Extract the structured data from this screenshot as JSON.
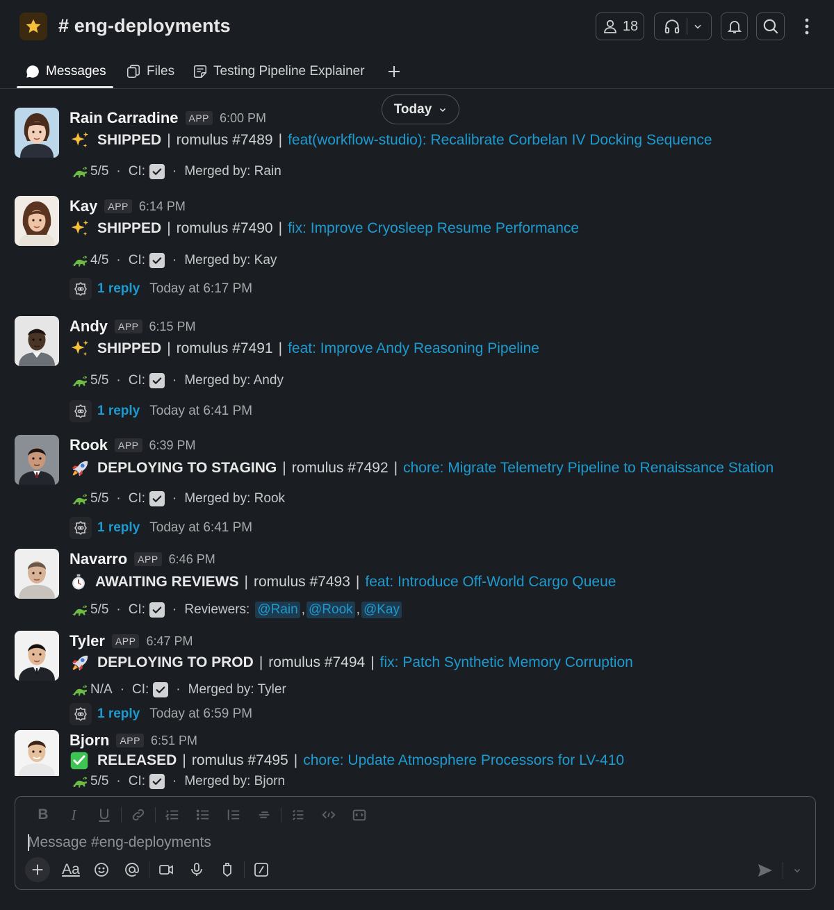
{
  "channel": {
    "name": "# eng-deployments",
    "member_count": "18"
  },
  "tabs": [
    {
      "label": "Messages"
    },
    {
      "label": "Files"
    },
    {
      "label": "Testing Pipeline Explainer"
    }
  ],
  "date_divider": "Today",
  "messages": [
    {
      "sender": "Rain Carradine",
      "badge": "APP",
      "time": "6:00 PM",
      "emoji": "sparkles",
      "status": "SHIPPED",
      "repo": "romulus #7489",
      "title": "feat(workflow-studio): Recalibrate Corbelan IV Docking Sequence",
      "score": "5/5",
      "ci_label": "CI:",
      "people_label": "Merged by: Rain"
    },
    {
      "sender": "Kay",
      "badge": "APP",
      "time": "6:14 PM",
      "emoji": "sparkles",
      "status": "SHIPPED",
      "repo": "romulus #7490",
      "title": "fix: Improve Cryosleep Resume Performance",
      "score": "4/5",
      "ci_label": "CI:",
      "people_label": "Merged by: Kay",
      "reply_label": "1 reply",
      "reply_time": "Today at 6:17 PM"
    },
    {
      "sender": "Andy",
      "badge": "APP",
      "time": "6:15 PM",
      "emoji": "sparkles",
      "status": "SHIPPED",
      "repo": "romulus #7491",
      "title": "feat: Improve Andy Reasoning Pipeline",
      "score": "5/5",
      "ci_label": "CI:",
      "people_label": "Merged by: Andy",
      "reply_label": "1 reply",
      "reply_time": "Today at 6:41 PM"
    },
    {
      "sender": "Rook",
      "badge": "APP",
      "time": "6:39 PM",
      "emoji": "rocket",
      "status": "DEPLOYING TO STAGING",
      "repo": "romulus #7492",
      "title": "chore: Migrate Telemetry Pipeline to Renaissance Station",
      "score": "5/5",
      "ci_label": "CI:",
      "people_label": "Merged by: Rook",
      "reply_label": "1 reply",
      "reply_time": "Today at 6:41 PM"
    },
    {
      "sender": "Navarro",
      "badge": "APP",
      "time": "6:46 PM",
      "emoji": "stopwatch",
      "status": "AWAITING REVIEWS",
      "repo": "romulus #7493",
      "title": "feat: Introduce Off-World Cargo Queue",
      "score": "5/5",
      "ci_label": "CI:",
      "people_label": "Reviewers:",
      "mentions": [
        "@Rain",
        "@Rook",
        "@Kay"
      ]
    },
    {
      "sender": "Tyler",
      "badge": "APP",
      "time": "6:47 PM",
      "emoji": "rocket",
      "status": "DEPLOYING TO PROD",
      "repo": "romulus #7494",
      "title": "fix: Patch Synthetic Memory Corruption",
      "score": "N/A",
      "ci_label": "CI:",
      "people_label": "Merged by: Tyler",
      "reply_label": "1 reply",
      "reply_time": "Today at 6:59 PM"
    },
    {
      "sender": "Bjorn",
      "badge": "APP",
      "time": "6:51 PM",
      "emoji": "check-mark",
      "status": "RELEASED",
      "repo": "romulus #7495",
      "title": "chore: Update Atmosphere Processors for LV-410",
      "score": "5/5",
      "ci_label": "CI:",
      "people_label": "Merged by: Bjorn"
    }
  ],
  "composer": {
    "placeholder": "Message #eng-deployments",
    "format_tools": [
      "bold-icon",
      "italic-icon",
      "underline-icon",
      "link-icon",
      "bulleted-list-icon",
      "dashed-list-icon",
      "numbered-list-icon",
      "strikethrough-icon",
      "checklist-icon",
      "code-icon",
      "code-block-icon"
    ],
    "bottom_tools": [
      "plus-icon",
      "text-format-icon",
      "emoji-icon",
      "mention-icon",
      "video-icon",
      "microphone-icon",
      "canvas-icon",
      "shortcut-slash-icon"
    ],
    "format_label": "Aa"
  },
  "colors": {
    "background": "#1a1d21",
    "link": "#1d9bd1",
    "mention_bg": "#1d3a4e",
    "star": "#f6c03b"
  }
}
